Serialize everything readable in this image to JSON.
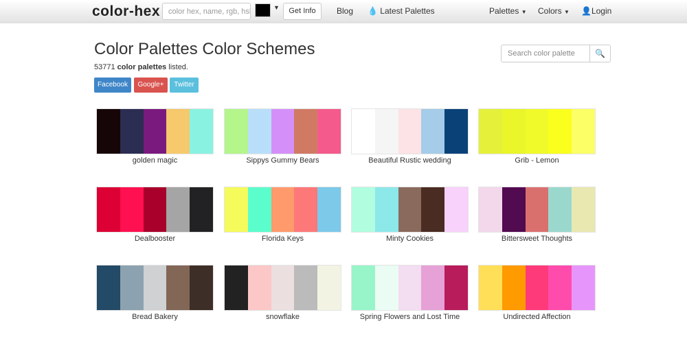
{
  "nav": {
    "logo": "color-hex",
    "search_placeholder": "color hex, name, rgb, hsl",
    "picker_color": "#000000",
    "get_info": "Get Info",
    "blog": "Blog",
    "latest": "Latest Palettes",
    "palettes": "Palettes",
    "colors": "Colors",
    "login": "Login"
  },
  "header": {
    "title": "Color Palettes Color Schemes",
    "count": "53771",
    "count_bold": "color palettes",
    "count_suffix": "listed.",
    "facebook": "Facebook",
    "google": "Google+",
    "twitter": "Twitter",
    "search_placeholder": "Search color palette"
  },
  "palettes": [
    {
      "name": "golden magic",
      "colors": [
        "#170607",
        "#2b2d52",
        "#7a1a7e",
        "#f5c96c",
        "#8af2e0"
      ]
    },
    {
      "name": "Sippys Gummy Bears",
      "colors": [
        "#b4f58c",
        "#b9defa",
        "#d490f8",
        "#d07a64",
        "#f55a8c"
      ]
    },
    {
      "name": "Beautiful Rustic wedding",
      "colors": [
        "#ffffff",
        "#f5f5f5",
        "#fde3e5",
        "#a5cce8",
        "#0a4278"
      ]
    },
    {
      "name": "Grib - Lemon",
      "colors": [
        "#e5f03a",
        "#eaf52a",
        "#f0fa2a",
        "#fbff1e",
        "#fcff66"
      ]
    },
    {
      "name": "Dealbooster",
      "colors": [
        "#dc0035",
        "#ff1050",
        "#a8002a",
        "#a5a5a5",
        "#222224"
      ]
    },
    {
      "name": "Florida Keys",
      "colors": [
        "#f6fb5c",
        "#5cfdcc",
        "#ff9a6c",
        "#fd7878",
        "#7cc9ea"
      ]
    },
    {
      "name": "Minty Cookies",
      "colors": [
        "#b0fde0",
        "#8de8ea",
        "#8a6a5c",
        "#4a2c22",
        "#f8d2fb"
      ]
    },
    {
      "name": "Bittersweet Thoughts",
      "colors": [
        "#f2d8ea",
        "#520a50",
        "#da706e",
        "#9ad8ce",
        "#e8e8b0"
      ]
    },
    {
      "name": "Bread Bakery",
      "colors": [
        "#234a66",
        "#8ca2b0",
        "#cfd1d3",
        "#826656",
        "#3e2e28"
      ]
    },
    {
      "name": "snowflake",
      "colors": [
        "#222222",
        "#fbc7c7",
        "#ebdfe0",
        "#bbbbbb",
        "#f3f3e3"
      ]
    },
    {
      "name": "Spring Flowers and Lost Time",
      "colors": [
        "#98f5c9",
        "#eafcf3",
        "#f3ddf1",
        "#e6a1d7",
        "#b81c5b"
      ]
    },
    {
      "name": "Undirected Affection",
      "colors": [
        "#ffdf57",
        "#ff9a00",
        "#ff3a7a",
        "#ff4cac",
        "#e696fa"
      ]
    }
  ]
}
